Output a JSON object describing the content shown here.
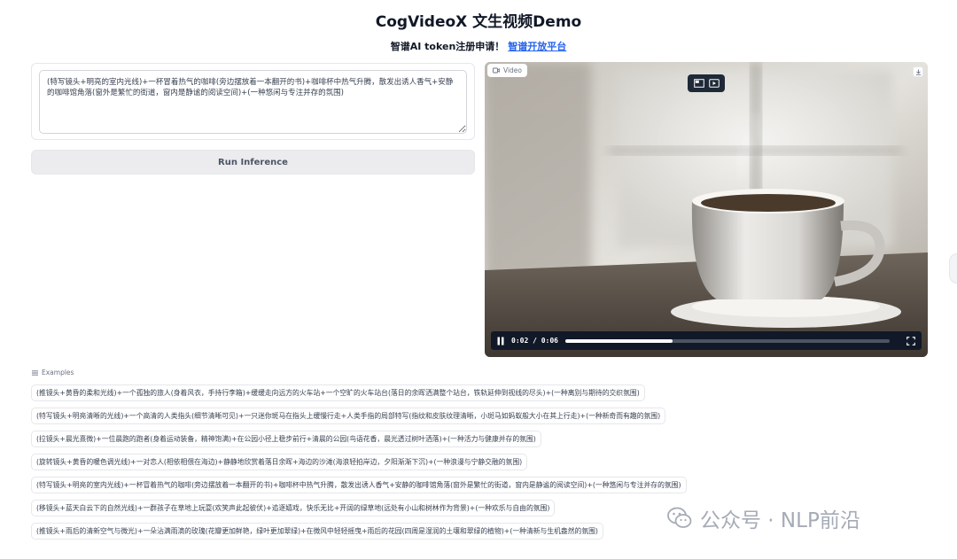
{
  "header": {
    "title": "CogVideoX 文生视频Demo",
    "register_text": "智谱AI token注册申请！",
    "register_link": "智谱开放平台"
  },
  "prompt": {
    "value": "(特写镜头+明亮的室内光线)+一杯冒着热气的咖啡(旁边摆放着一本翻开的书)+咖啡杯中热气升腾，散发出诱人香气+安静的咖啡馆角落(窗外是繁忙的街道，窗内是静谧的阅读空间)+(一种悠闲与专注并存的氛围)"
  },
  "run_button": {
    "label": "Run Inference"
  },
  "video": {
    "tag_label": "Video",
    "time": "0:02 / 0:06",
    "progress": 0.33
  },
  "examples": {
    "label": "Examples",
    "items": [
      "(推镜头+黄昏的柔和光线)+一个孤独的旅人(身着风衣，手持行李箱)+缓缓走向远方的火车站+一个空旷的火车站台(落日的余晖洒满整个站台，铁轨延伸到视线的尽头)+(一种离别与期待的交织氛围)",
      "(特写镜头+明亮清晰的光线)+一个高清的人类指头(细节清晰可见)+一只迷你斑马在指头上缓慢行走+人类手指的局部特写(指纹和皮肤纹理清晰，小斑马如蚂蚁般大小在其上行走)+(一种新奇而有趣的氛围)",
      "(拉镜头+晨光熹微)+一位晨跑的跑者(身着运动装备，精神饱满)+在公园小径上稳步前行+清晨的公园(鸟语花香，晨光透过树叶洒落)+(一种活力与健康并存的氛围)",
      "(旋转镜头+黄昏的暖色调光线)+一对恋人(相依相偎在海边)+静静地欣赏着落日余晖+海边的沙滩(海浪轻拍岸边，夕阳渐渐下沉)+(一种浪漫与宁静交融的氛围)",
      "(特写镜头+明亮的室内光线)+一杯冒着热气的咖啡(旁边摆放着一本翻开的书)+咖啡杯中热气升腾，散发出诱人香气+安静的咖啡馆角落(窗外是繁忙的街道，窗内是静谧的阅读空间)+(一种悠闲与专注并存的氛围)",
      "(移镜头+蓝天白云下的自然光线)+一群孩子在草地上玩耍(欢笑声此起彼伏)+追逐嬉戏，快乐无比+开阔的绿草地(远处有小山和树林作为背景)+(一种欢乐与自由的氛围)",
      "(推镜头+雨后的清新空气与微光)+一朵沾满雨滴的玫瑰(花瓣更加鲜艳，绿叶更加翠绿)+在微风中轻轻摇曳+雨后的花园(四周是湿润的土壤和翠绿的植物)+(一种清新与生机盎然的氛围)"
    ]
  },
  "watermark": {
    "text": "公众号 · NLP前沿"
  },
  "colors": {
    "link": "#2563eb",
    "button_bg": "#ececef",
    "controls_bg": "#111827"
  },
  "icons": [
    "video-camera-icon",
    "download-icon",
    "pip-icon",
    "cast-icon",
    "pause-icon",
    "fullscreen-icon",
    "list-icon",
    "wechat-icon"
  ]
}
